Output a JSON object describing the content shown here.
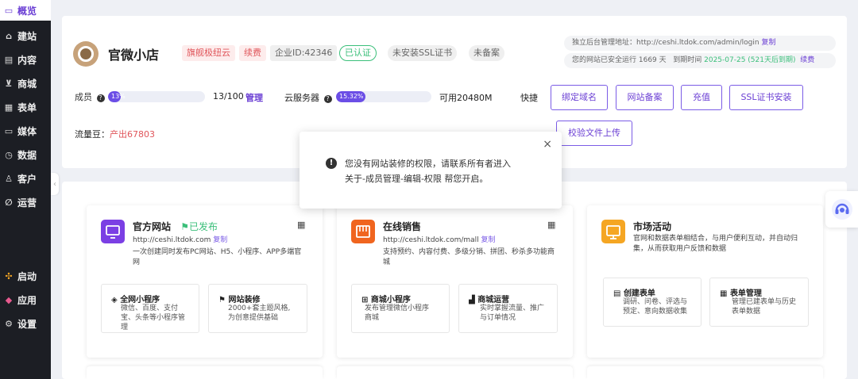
{
  "sidebar": {
    "items": [
      {
        "icon": "monitor-icon",
        "glyph": "▭",
        "label": "概览"
      },
      {
        "icon": "home-icon",
        "glyph": "⌂",
        "label": "建站"
      },
      {
        "icon": "document-icon",
        "glyph": "▤",
        "label": "内容"
      },
      {
        "icon": "cart-icon",
        "glyph": "⊻",
        "label": "商城"
      },
      {
        "icon": "form-icon",
        "glyph": "▦",
        "label": "表单"
      },
      {
        "icon": "media-icon",
        "glyph": "▭",
        "label": "媒体"
      },
      {
        "icon": "clock-icon",
        "glyph": "◷",
        "label": "数据"
      },
      {
        "icon": "user-icon",
        "glyph": "♙",
        "label": "客户"
      },
      {
        "icon": "link-icon",
        "glyph": "∅",
        "label": "运营"
      },
      {
        "icon": "launch-icon",
        "glyph": "✣",
        "label": "启动"
      },
      {
        "icon": "apps-icon",
        "glyph": "◆",
        "label": "应用"
      },
      {
        "icon": "gear-icon",
        "glyph": "⚙",
        "label": "设置"
      }
    ],
    "collapse_glyph": "‹"
  },
  "shop": {
    "name": "官微小店",
    "tags": [
      "旗舰极纽云",
      "续费",
      "企业ID:42346",
      "已认证",
      "未安装SSL证书",
      "未备案"
    ]
  },
  "info": {
    "admin_label": "独立后台管理地址：",
    "admin_url": "http://ceshi.ltdok.com/admin/login",
    "copy": "复制",
    "run_text": "您的网站已安全运行 1669 天",
    "expire_label": "到期时间",
    "expire_value": "2025-07-25 (521天后到期)",
    "renew": "续费"
  },
  "stats": {
    "member_label": "成员",
    "member_percent": 13,
    "member_percent_text": "13%",
    "member_count": "13/100",
    "manage": "管理",
    "cloud_label": "云服务器",
    "cloud_percent": 15.32,
    "cloud_percent_text": "15.32%",
    "available": "可用20480M",
    "quick_label": "快捷",
    "traffic_label": "流量豆：",
    "traffic_value": "产出67803"
  },
  "quick_buttons": [
    "绑定域名",
    "网站备案",
    "充值",
    "SSL证书安装",
    "校验文件上传"
  ],
  "popup": {
    "line1": "您没有网站装修的权限，请联系所有者进入",
    "line2": "关于-成员管理-编辑-权限 帮您开启。",
    "close": "×",
    "warn_glyph": "!"
  },
  "cards": [
    {
      "icon_color": "#7b3fe4",
      "title": "官方网站",
      "badge": "已发布",
      "url": "http://ceshi.ltdok.com",
      "copy": "复制",
      "desc1": "一次创建同时发布PC网站、H5、小程序、APP多端官",
      "desc2": "网",
      "subs": [
        {
          "icon": "mini-program-icon",
          "glyph": "◈",
          "title": "全网小程序",
          "d1": "微信、百度、支付",
          "d2": "宝、头条等小程序管",
          "d3": "理"
        },
        {
          "icon": "decorate-icon",
          "glyph": "⚑",
          "title": "网站装修",
          "d1": "2000+套主题风格,",
          "d2": "为创意提供基础",
          "d3": ""
        }
      ]
    },
    {
      "icon_color": "#f0651f",
      "title": "在线销售",
      "badge": "",
      "url": "http://ceshi.ltdok.com/mall",
      "copy": "复制",
      "desc1": "支持预约、内容付费、多级分销、拼团、秒杀多功能商",
      "desc2": "城",
      "subs": [
        {
          "icon": "store-icon",
          "glyph": "⊞",
          "title": "商城小程序",
          "d1": "发布管理微信小程序",
          "d2": "商城",
          "d3": ""
        },
        {
          "icon": "bar-chart-icon",
          "glyph": "▟",
          "title": "商城运营",
          "d1": "实时掌握流量、推广",
          "d2": "与订单情况",
          "d3": ""
        }
      ]
    },
    {
      "icon_color": "#f5a623",
      "title": "市场活动",
      "badge": "",
      "url": "",
      "copy": "",
      "desc1": "官网和数据表单相结合，与用户便利互动，并自动归",
      "desc2": "集，从而获取用户反馈和数据",
      "subs": [
        {
          "icon": "create-form-icon",
          "glyph": "▤",
          "title": "创建表单",
          "d1": "调研、问卷、评选与",
          "d2": "预定、意向数据收集",
          "d3": ""
        },
        {
          "icon": "form-manage-icon",
          "glyph": "▦",
          "title": "表单管理",
          "d1": "管理已建表单与历史",
          "d2": "表单数据",
          "d3": ""
        }
      ]
    }
  ],
  "colors": {
    "accent": "#6b3fd4",
    "green": "#3bbf7a",
    "red": "#e0565b"
  }
}
